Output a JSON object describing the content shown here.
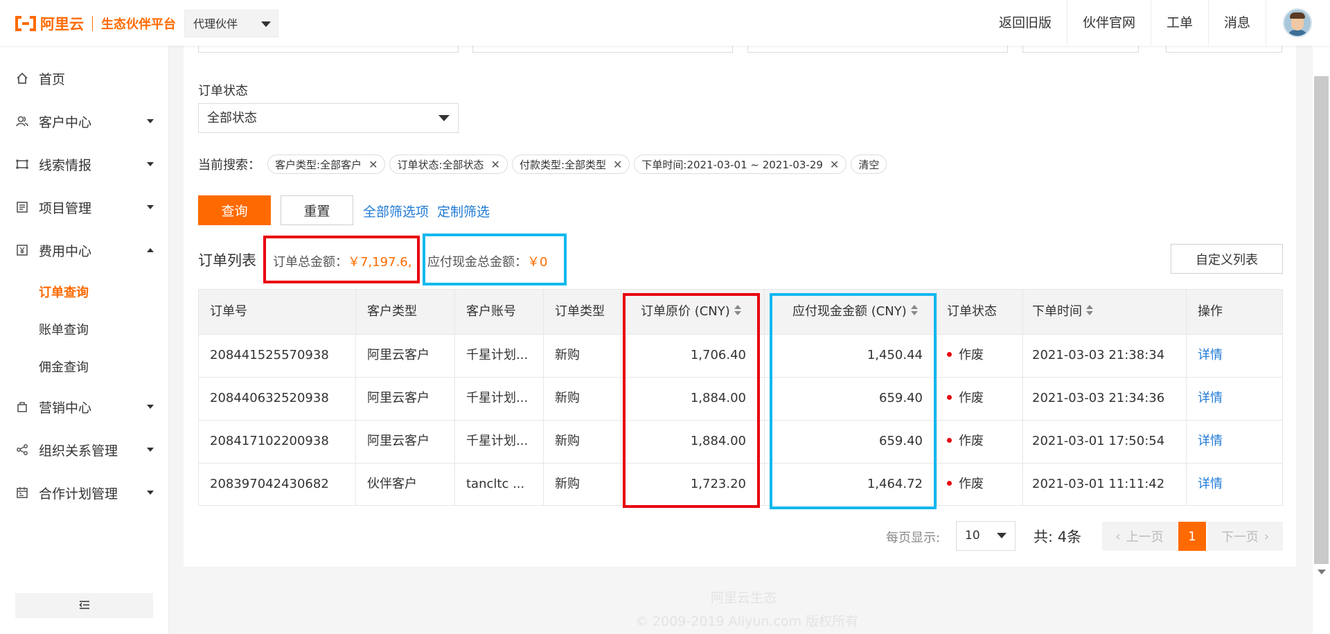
{
  "header": {
    "logo_brand": "阿里云",
    "logo_sub": "生态伙伴平台",
    "role_value": "代理伙伴",
    "links": [
      "返回旧版",
      "伙伴官网",
      "工单",
      "消息"
    ]
  },
  "sidebar": {
    "items": [
      {
        "label": "首页",
        "icon": "home-icon"
      },
      {
        "label": "客户中心",
        "icon": "users-icon"
      },
      {
        "label": "线索情报",
        "icon": "radar-icon"
      },
      {
        "label": "项目管理",
        "icon": "list-icon"
      },
      {
        "label": "费用中心",
        "icon": "yen-icon"
      },
      {
        "label": "营销中心",
        "icon": "bag-icon"
      },
      {
        "label": "组织关系管理",
        "icon": "share-icon"
      },
      {
        "label": "合作计划管理",
        "icon": "calendar-icon"
      }
    ],
    "sub_items": [
      "订单查询",
      "账单查询",
      "佣金查询"
    ]
  },
  "filters": {
    "status_label": "订单状态",
    "status_value": "全部状态",
    "current_search_label": "当前搜索：",
    "tags": [
      "客户类型:全部客户",
      "订单状态:全部状态",
      "付款类型:全部类型",
      "下单时间:2021-03-01 ~ 2021-03-29"
    ],
    "clear_label": "清空",
    "query_label": "查询",
    "reset_label": "重置",
    "all_filters_label": "全部筛选项",
    "custom_filters_label": "定制筛选"
  },
  "summary": {
    "list_title": "订单列表",
    "total_label": "订单总金额：",
    "total_value": "￥7,197.6,",
    "cash_label": "应付现金总金额：",
    "cash_value": "￥0",
    "custom_list_label": "自定义列表"
  },
  "table": {
    "headers": [
      "订单号",
      "客户类型",
      "客户账号",
      "订单类型",
      "订单原价 (CNY)",
      "应付现金金额 (CNY)",
      "订单状态",
      "下单时间",
      "操作"
    ],
    "rows": [
      [
        "208441525570938",
        "阿里云客户",
        "千星计划...",
        "新购",
        "1,706.40",
        "1,450.44",
        "作废",
        "2021-03-03 21:38:34",
        "详情"
      ],
      [
        "208440632520938",
        "阿里云客户",
        "千星计划...",
        "新购",
        "1,884.00",
        "659.40",
        "作废",
        "2021-03-03 21:34:36",
        "详情"
      ],
      [
        "208417102200938",
        "阿里云客户",
        "千星计划...",
        "新购",
        "1,884.00",
        "659.40",
        "作废",
        "2021-03-01 17:50:54",
        "详情"
      ],
      [
        "208397042430682",
        "伙伴客户",
        "tancltc ...",
        "新购",
        "1,723.20",
        "1,464.72",
        "作废",
        "2021-03-01 11:11:42",
        "详情"
      ]
    ]
  },
  "pagination": {
    "page_size_label": "每页显示:",
    "page_size_value": "10",
    "total_label": "共:",
    "total_count": "4条",
    "prev_label": "上一页",
    "current_page": "1",
    "next_label": "下一页"
  },
  "footer": {
    "line1": "阿里云生态",
    "line2": "© 2009-2019 Aliyun.com 版权所有"
  },
  "colors": {
    "accent": "#ff6a00",
    "link": "#1f7ad6",
    "highlight_red": "#e8000f",
    "highlight_blue": "#12b8ee"
  }
}
